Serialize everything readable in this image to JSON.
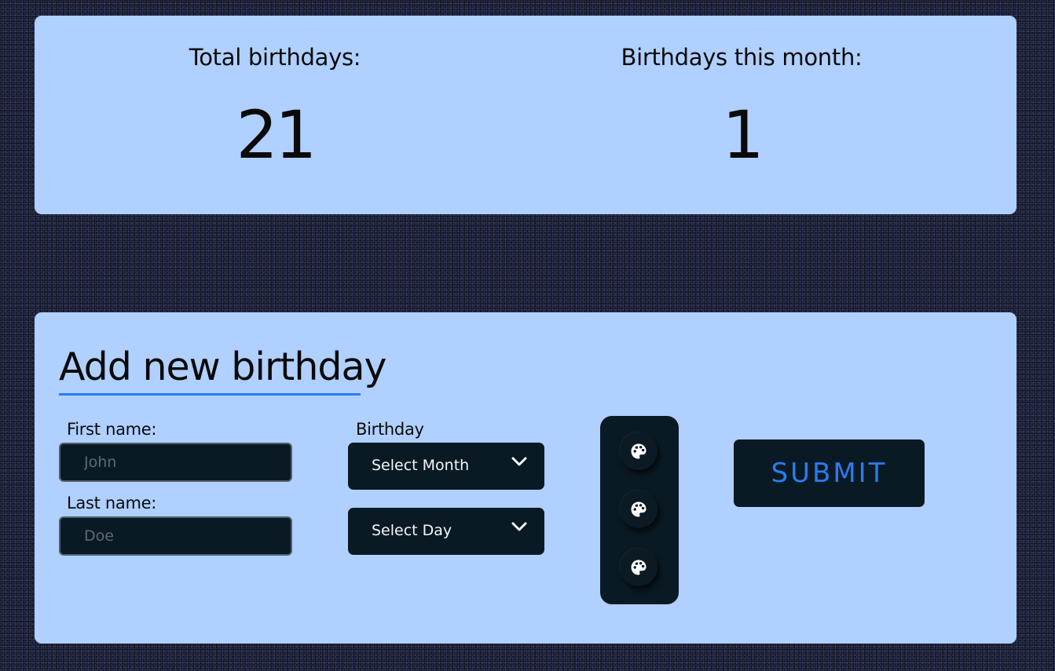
{
  "stats": {
    "total_label": "Total birthdays:",
    "total_value": "21",
    "month_label": "Birthdays this month:",
    "month_value": "1"
  },
  "form": {
    "title": "Add new birthday",
    "first_name_label": "First name:",
    "first_name_placeholder": "John",
    "last_name_label": "Last name:",
    "last_name_placeholder": "Doe",
    "birthday_label": "Birthday",
    "month_select": "Select Month",
    "day_select": "Select Day",
    "palette_icons": [
      "palette-icon",
      "palette-icon",
      "palette-icon"
    ],
    "submit_label": "SUBMIT"
  },
  "colors": {
    "panel": "#b0d0ff",
    "dark": "#0a1a24",
    "accent": "#2a7cf0"
  }
}
